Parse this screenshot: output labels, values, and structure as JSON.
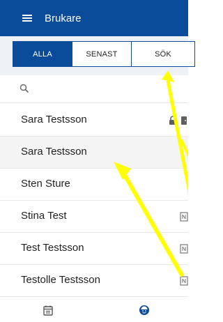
{
  "appbar": {
    "title": "Brukare",
    "menu_icon": "hamburger-menu-icon"
  },
  "tabs": [
    {
      "label": "ALLA",
      "active": true
    },
    {
      "label": "SENAST",
      "active": false
    },
    {
      "label": "SÖK",
      "active": false
    }
  ],
  "search": {
    "placeholder": "",
    "icon": "search-icon"
  },
  "people": [
    {
      "name": "Sara Testsson",
      "icons": [
        "lock-icon",
        "door-icon"
      ]
    },
    {
      "name": "Sara Testsson",
      "icons": []
    },
    {
      "name": "Sten Sture",
      "icons": []
    },
    {
      "name": "Stina Test",
      "icons": [
        "nfc-tag-icon"
      ]
    },
    {
      "name": "Test Testsson",
      "icons": [
        "nfc-tag-icon"
      ]
    },
    {
      "name": "Testolle Testsson",
      "icons": [
        "nfc-tag-icon"
      ]
    }
  ],
  "bottom_nav": [
    {
      "icon": "calendar-icon"
    },
    {
      "icon": "user-face-icon"
    }
  ],
  "colors": {
    "primary": "#0b4c9a",
    "annotation_arrow": "#ffff00"
  }
}
